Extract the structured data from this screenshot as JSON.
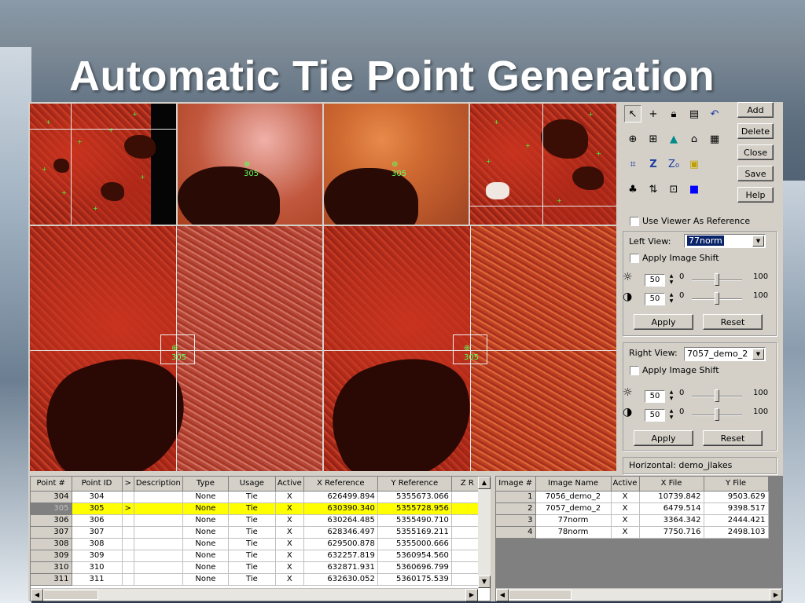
{
  "slide_title": "Automatic Tie Point Generation",
  "point_labels": {
    "top_left_zoom": "305",
    "top_right_zoom": "305",
    "main_left": "305",
    "main_right": "305"
  },
  "buttons": {
    "add": "Add",
    "delete": "Delete",
    "close": "Close",
    "save": "Save",
    "help": "Help",
    "apply": "Apply",
    "reset": "Reset"
  },
  "options": {
    "use_viewer_ref": "Use Viewer As Reference",
    "apply_image_shift": "Apply Image Shift"
  },
  "left_view": {
    "label": "Left View:",
    "value": "77norm",
    "brightness": "50",
    "contrast": "50",
    "min": "0",
    "max": "100"
  },
  "right_view": {
    "label": "Right View:",
    "value": "7057_demo_2",
    "brightness": "50",
    "contrast": "50",
    "min": "0",
    "max": "100"
  },
  "horizontal": "Horizontal: demo_jlakes",
  "points_table": {
    "headers": [
      "Point #",
      "Point ID",
      ">",
      "Description",
      "Type",
      "Usage",
      "Active",
      "X Reference",
      "Y Reference",
      "Z R"
    ],
    "rows": [
      {
        "num": "304",
        "id": "304",
        "sel": "",
        "desc": "",
        "type": "None",
        "usage": "Tie",
        "active": "X",
        "x": "626499.894",
        "y": "5355673.066"
      },
      {
        "num": "305",
        "id": "305",
        "sel": ">",
        "desc": "",
        "type": "None",
        "usage": "Tie",
        "active": "X",
        "x": "630390.340",
        "y": "5355728.956"
      },
      {
        "num": "306",
        "id": "306",
        "sel": "",
        "desc": "",
        "type": "None",
        "usage": "Tie",
        "active": "X",
        "x": "630264.485",
        "y": "5355490.710"
      },
      {
        "num": "307",
        "id": "307",
        "sel": "",
        "desc": "",
        "type": "None",
        "usage": "Tie",
        "active": "X",
        "x": "628346.497",
        "y": "5355169.211"
      },
      {
        "num": "308",
        "id": "308",
        "sel": "",
        "desc": "",
        "type": "None",
        "usage": "Tie",
        "active": "X",
        "x": "629500.878",
        "y": "5355000.666"
      },
      {
        "num": "309",
        "id": "309",
        "sel": "",
        "desc": "",
        "type": "None",
        "usage": "Tie",
        "active": "X",
        "x": "632257.819",
        "y": "5360954.560"
      },
      {
        "num": "310",
        "id": "310",
        "sel": "",
        "desc": "",
        "type": "None",
        "usage": "Tie",
        "active": "X",
        "x": "632871.931",
        "y": "5360696.799"
      },
      {
        "num": "311",
        "id": "311",
        "sel": "",
        "desc": "",
        "type": "None",
        "usage": "Tie",
        "active": "X",
        "x": "632630.052",
        "y": "5360175.539"
      }
    ]
  },
  "images_table": {
    "headers": [
      "Image #",
      "Image Name",
      "Active",
      "X File",
      "Y File"
    ],
    "rows": [
      {
        "num": "1",
        "name": "7056_demo_2",
        "active": "X",
        "x": "10739.842",
        "y": "9503.629"
      },
      {
        "num": "2",
        "name": "7057_demo_2",
        "active": "X",
        "x": "6479.514",
        "y": "9398.517"
      },
      {
        "num": "3",
        "name": "77norm",
        "active": "X",
        "x": "3364.342",
        "y": "2444.421"
      },
      {
        "num": "4",
        "name": "78norm",
        "active": "X",
        "x": "7750.716",
        "y": "2498.103"
      }
    ]
  },
  "colors": {
    "selected_row": "#ffff00",
    "point_marker": "#3cff3c",
    "combo_selected": "#0a246a"
  }
}
